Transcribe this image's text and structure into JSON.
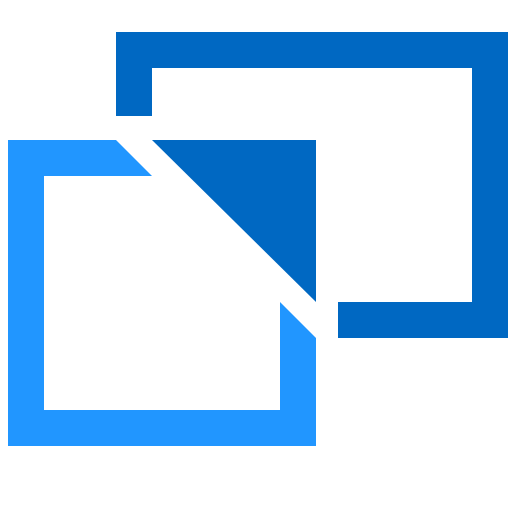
{
  "icon": {
    "name": "picture-in-picture-icon",
    "colors": {
      "background": "#ffffff",
      "back_window": "#0068c2",
      "front_window": "#2196ff",
      "arrow": "#0068c2"
    }
  }
}
